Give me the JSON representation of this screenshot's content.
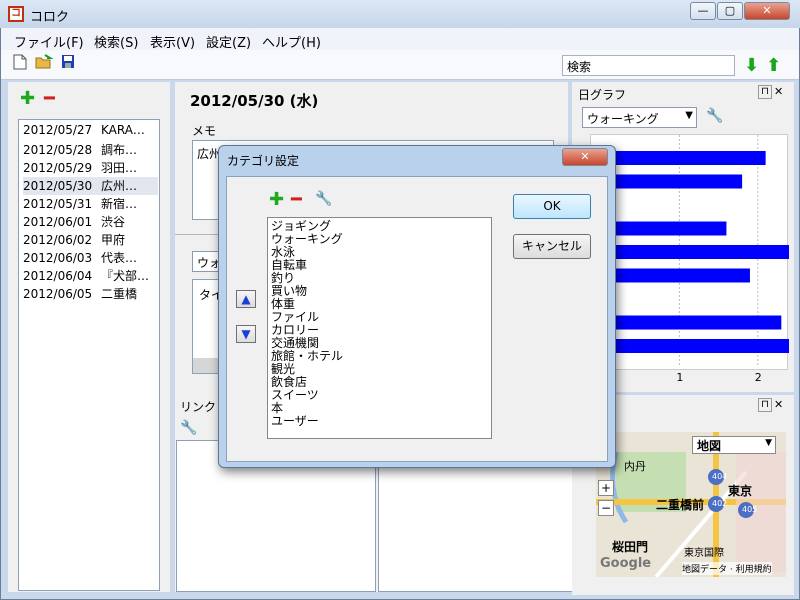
{
  "app": {
    "title": "コロク",
    "icon": "コ"
  },
  "window_controls": {
    "minimize": "—",
    "maximize": "▢",
    "close": "✕"
  },
  "menu": [
    "ファイル(F)",
    "検索(S)",
    "表示(V)",
    "設定(Z)",
    "ヘルプ(H)"
  ],
  "toolbar": {
    "search_placeholder": "検索",
    "search_value": "検索"
  },
  "date_list": [
    {
      "date": "2012/05/27",
      "title": "KARA…"
    },
    {
      "date": "2012/05/28",
      "title": "調布…"
    },
    {
      "date": "2012/05/29",
      "title": "羽田…"
    },
    {
      "date": "2012/05/30",
      "title": "広州…",
      "selected": true
    },
    {
      "date": "2012/05/31",
      "title": "新宿…"
    },
    {
      "date": "2012/06/01",
      "title": "渋谷"
    },
    {
      "date": "2012/06/02",
      "title": "甲府"
    },
    {
      "date": "2012/06/03",
      "title": "代表…"
    },
    {
      "date": "2012/06/04",
      "title": "『犬部…"
    },
    {
      "date": "2012/06/05",
      "title": "二重橋"
    }
  ],
  "main": {
    "date_heading": "2012/05/30 (水)",
    "memo_label": "メモ",
    "memo_text": "広州",
    "category_combo": "ウォー",
    "type_label": "タイ",
    "link_label": "リンク"
  },
  "graph_panel": {
    "title": "日グラフ",
    "selected_category": "ウォーキング",
    "pin": "ᚌ",
    "close": "✕",
    "tick_labels": [
      "1",
      "2"
    ]
  },
  "chart_data": {
    "type": "bar",
    "orientation": "horizontal",
    "xlim": [
      0,
      2.5
    ],
    "xticks": [
      "1",
      "2"
    ],
    "values": [
      2.1,
      1.8,
      0,
      1.6,
      2.4,
      1.9,
      0,
      2.3,
      2.5
    ],
    "color": "#0000ff"
  },
  "map_panel": {
    "map_type": "地図",
    "labels": [
      "内丹",
      "東京",
      "二重橋前",
      "桜田門",
      "東京国際",
      "Google",
      "地図データ · 利用規約"
    ],
    "road_numbers": [
      "404",
      "402",
      "405"
    ]
  },
  "dialog": {
    "title": "カテゴリ設定",
    "ok_label": "OK",
    "cancel_label": "キャンセル",
    "categories": [
      "ジョギング",
      "ウォーキング",
      "水泳",
      "自転車",
      "釣り",
      "買い物",
      "体重",
      "ファイル",
      "カロリー",
      "交通機関",
      "旅館・ホテル",
      "観光",
      "飲食店",
      "スイーツ",
      "本",
      "ユーザー"
    ],
    "up_arrow": "▲",
    "down_arrow": "▼"
  }
}
